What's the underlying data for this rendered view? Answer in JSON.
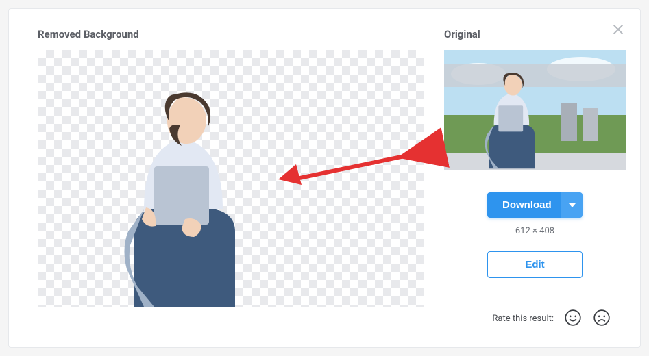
{
  "left": {
    "title": "Removed Background"
  },
  "right": {
    "title": "Original",
    "download_label": "Download",
    "dimensions": "612 × 408",
    "edit_label": "Edit"
  },
  "rate": {
    "label": "Rate this result:"
  }
}
